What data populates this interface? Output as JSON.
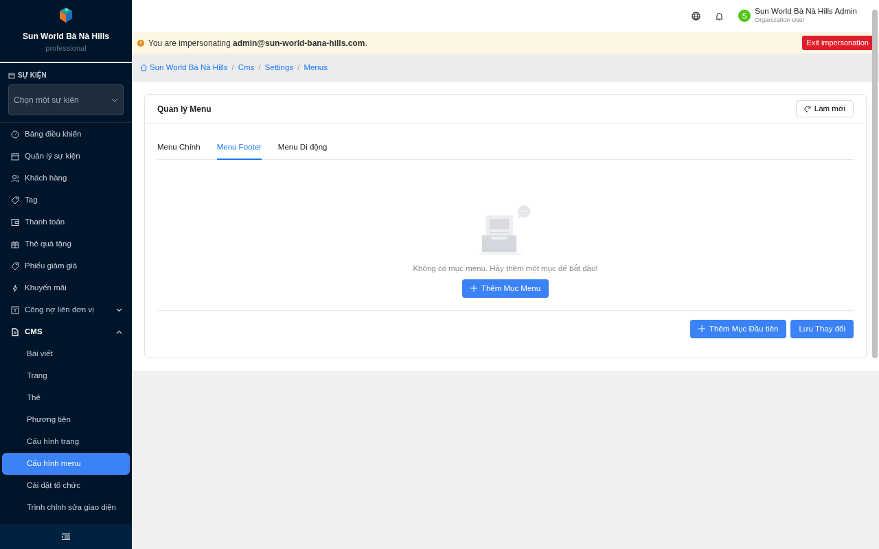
{
  "sidebar": {
    "brand": "Sun World Bà Nà Hills",
    "plan": "professional",
    "event_section": {
      "label": "SỰ KIỆN",
      "placeholder": "Chọn một sự kiện"
    },
    "items": [
      {
        "label": "Bảng điều khiển"
      },
      {
        "label": "Quản lý sự kiện"
      },
      {
        "label": "Khách hàng"
      },
      {
        "label": "Tag"
      },
      {
        "label": "Thanh toán"
      },
      {
        "label": "Thẻ quà tặng"
      },
      {
        "label": "Phiếu giảm giá"
      },
      {
        "label": "Khuyến mãi"
      },
      {
        "label": "Công nợ liên đơn vị",
        "expanded": false
      },
      {
        "label": "CMS",
        "expanded": true,
        "children": [
          {
            "label": "Bài viết",
            "selected": false
          },
          {
            "label": "Trang",
            "selected": false
          },
          {
            "label": "Thẻ",
            "selected": false
          },
          {
            "label": "Phương tiện",
            "selected": false
          },
          {
            "label": "Cấu hình trang",
            "selected": false
          },
          {
            "label": "Cấu hình menu",
            "selected": true
          },
          {
            "label": "Cài đặt tổ chức",
            "selected": false
          },
          {
            "label": "Trình chỉnh sửa giao diện",
            "selected": false
          }
        ]
      }
    ]
  },
  "topbar": {
    "user": {
      "initial": "S",
      "name": "Sun World Bà Nà Hills Admin",
      "role": "Organization User"
    }
  },
  "impersonation": {
    "text": "You are impersonating **admin@sun-world-bana-hills.com**.",
    "button": "Exit impersonation"
  },
  "breadcrumb": {
    "separator": "/",
    "items": [
      "Sun World Bà Nà Hills",
      "Cms",
      "Settings",
      "Menus"
    ]
  },
  "card": {
    "title": "Quản lý Menu",
    "refresh_button": "Làm mới",
    "tabs": [
      {
        "label": "Menu Chính",
        "selected": false
      },
      {
        "label": "Menu Footer",
        "selected": true
      },
      {
        "label": "Menu Di động",
        "selected": false
      }
    ],
    "empty_message": "Không có mục menu. Hãy thêm một mục để bắt đầu!",
    "add_button": "Thêm Mục Menu",
    "footer_buttons": [
      {
        "label": "Thêm Mục Đầu tiên",
        "kind": "add"
      },
      {
        "label": "Lưu Thay đổi",
        "kind": "save"
      }
    ]
  }
}
